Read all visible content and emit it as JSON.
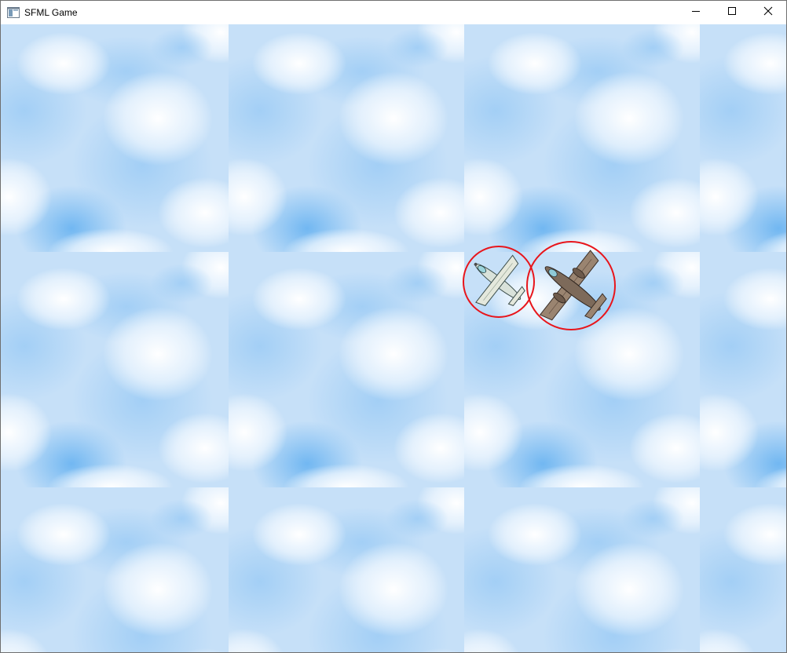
{
  "window": {
    "title": "SFML Game",
    "icon": "sfml-app-icon",
    "controls": {
      "minimize_icon": "minimize-icon",
      "maximize_icon": "maximize-icon",
      "close_icon": "close-icon"
    }
  },
  "scene": {
    "background": "tiled-cloud-sky",
    "colors": {
      "sky_light": "#dbeafb",
      "sky_mid": "#a9d1f5",
      "sky_deep": "#6fb5f0",
      "cloud_white": "#f7fbff",
      "collision_circle": "#e8151b"
    },
    "entities": [
      {
        "name": "player-aircraft",
        "icon": "fighter-plane-icon",
        "bounding_circle": true
      },
      {
        "name": "enemy-aircraft",
        "icon": "bomber-plane-icon",
        "bounding_circle": true
      }
    ]
  }
}
